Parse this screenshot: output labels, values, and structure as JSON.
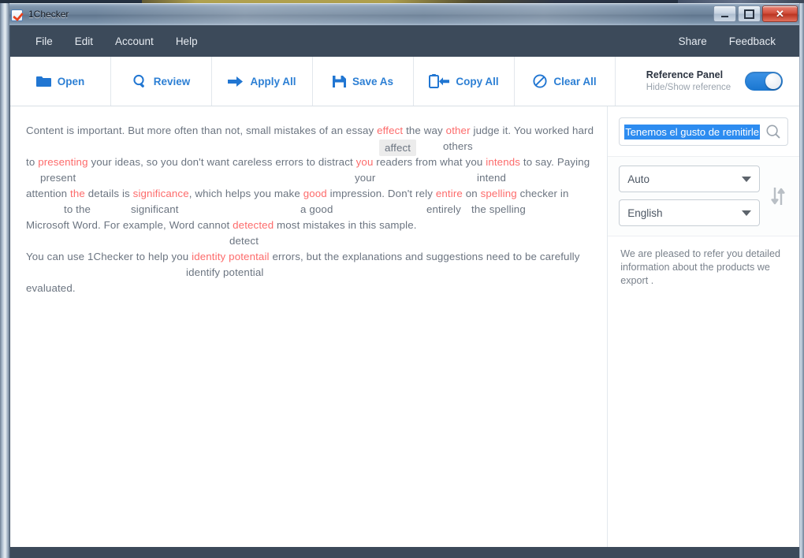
{
  "window": {
    "title": "1Checker",
    "app_icon": "checkbox-check-icon",
    "controls": {
      "minimize": "–",
      "maximize": "□",
      "close": "✕"
    },
    "ghost_text": ""
  },
  "menubar": {
    "items": [
      {
        "label": "File",
        "name": "menu-file"
      },
      {
        "label": "Edit",
        "name": "menu-edit"
      },
      {
        "label": "Account",
        "name": "menu-account"
      },
      {
        "label": "Help",
        "name": "menu-help"
      }
    ],
    "right_items": [
      {
        "label": "Share",
        "name": "menu-share"
      },
      {
        "label": "Feedback",
        "name": "menu-feedback"
      }
    ]
  },
  "toolbar": {
    "buttons": [
      {
        "label": "Open",
        "icon": "folder-icon"
      },
      {
        "label": "Review",
        "icon": "magnifier-icon"
      },
      {
        "label": "Apply All",
        "icon": "arrow-right-icon"
      },
      {
        "label": "Save As",
        "icon": "floppy-disk-icon"
      },
      {
        "label": "Copy All",
        "icon": "clipboard-arrow-left-icon"
      },
      {
        "label": "Clear All",
        "icon": "no-entry-icon"
      }
    ],
    "reference_panel": {
      "title": "Reference Panel",
      "subtitle": "Hide/Show reference",
      "toggle_on": true
    }
  },
  "document": {
    "lines": [
      {
        "segments": [
          {
            "text": "Content is important. But more often than not, small mistakes of an essay ",
            "err": false
          },
          {
            "text": "effect",
            "err": true
          },
          {
            "text": " the way ",
            "err": false
          },
          {
            "text": "other",
            "err": true
          },
          {
            "text": " judge it. You worked hard",
            "err": false
          }
        ],
        "suggestions": [
          {
            "text": "affect",
            "indent": 455,
            "highlight": true
          },
          {
            "text": "others",
            "indent": 529,
            "highlight": false
          }
        ]
      },
      {
        "segments": [
          {
            "text": "to ",
            "err": false
          },
          {
            "text": "presenting",
            "err": true
          },
          {
            "text": " your ideas, so you don't want careless errors to distract ",
            "err": false
          },
          {
            "text": "you",
            "err": true
          },
          {
            "text": " readers from what you ",
            "err": false
          },
          {
            "text": "intends",
            "err": true
          },
          {
            "text": " to say. Paying",
            "err": false
          }
        ],
        "suggestions": [
          {
            "text": "present",
            "indent": 18,
            "highlight": false
          },
          {
            "text": "your",
            "indent": 417,
            "highlight": false
          },
          {
            "text": "intend",
            "indent": 572,
            "highlight": false
          }
        ]
      },
      {
        "segments": [
          {
            "text": "attention ",
            "err": false
          },
          {
            "text": "the",
            "err": true
          },
          {
            "text": " details is ",
            "err": false
          },
          {
            "text": "significance",
            "err": true
          },
          {
            "text": ", which helps you make ",
            "err": false
          },
          {
            "text": "good",
            "err": true
          },
          {
            "text": " impression. Don't rely ",
            "err": false
          },
          {
            "text": "entire",
            "err": true
          },
          {
            "text": " on ",
            "err": false
          },
          {
            "text": "spelling",
            "err": true
          },
          {
            "text": " checker in",
            "err": false
          }
        ],
        "suggestions": [
          {
            "text": "to the",
            "indent": 48,
            "highlight": false
          },
          {
            "text": "significant",
            "indent": 133,
            "highlight": false
          },
          {
            "text": "a good",
            "indent": 348,
            "highlight": false
          },
          {
            "text": "entirely",
            "indent": 508,
            "highlight": false
          },
          {
            "text": "the spelling",
            "indent": 565,
            "highlight": false
          }
        ]
      },
      {
        "segments": [
          {
            "text": "Microsoft Word. For example, Word cannot ",
            "err": false
          },
          {
            "text": "detected",
            "err": true
          },
          {
            "text": " most mistakes in this sample.",
            "err": false
          }
        ],
        "suggestions": [
          {
            "text": "detect",
            "indent": 258,
            "highlight": false
          }
        ]
      },
      {
        "segments": [
          {
            "text": "You can use 1Checker to help you ",
            "err": false
          },
          {
            "text": "identity potentail",
            "err": true
          },
          {
            "text": " errors, but the explanations and suggestions need to be carefully",
            "err": false
          }
        ],
        "suggestions": [
          {
            "text": "identify potential",
            "indent": 203,
            "highlight": false
          }
        ]
      },
      {
        "segments": [
          {
            "text": "evaluated.",
            "err": false
          }
        ],
        "suggestions": []
      }
    ]
  },
  "panel": {
    "search": {
      "value": "Tenemos el gusto de remitirle",
      "icon": "magnifier-icon"
    },
    "source_language": {
      "value": "Auto",
      "icon": "chevron-down-icon"
    },
    "target_language": {
      "value": "English",
      "icon": "chevron-down-icon"
    },
    "swap_icon": "swap-vertical-icon",
    "result": "We are pleased to refer you detailed information about the products we export ."
  }
}
